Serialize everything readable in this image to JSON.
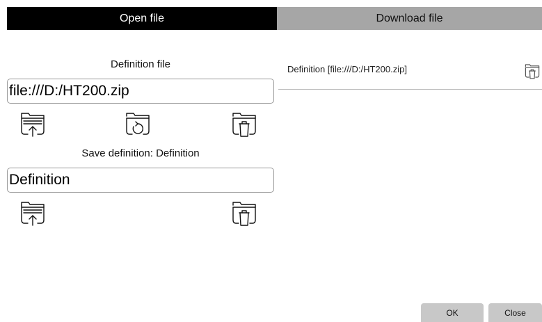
{
  "tabs": {
    "open_file": "Open file",
    "download_file": "Download file"
  },
  "definition_file": {
    "heading": "Definition file",
    "value": "file:///D:/HT200.zip"
  },
  "save_definition": {
    "heading": "Save definition: Definition",
    "value": "Definition"
  },
  "download_list": {
    "items": [
      {
        "label": "Definition [file:///D:/HT200.zip]"
      }
    ]
  },
  "buttons": {
    "ok": "OK",
    "close": "Close"
  },
  "colors": {
    "active_tab": "#000000",
    "inactive_tab": "#a6a6a6",
    "button": "#c8c8c8"
  }
}
